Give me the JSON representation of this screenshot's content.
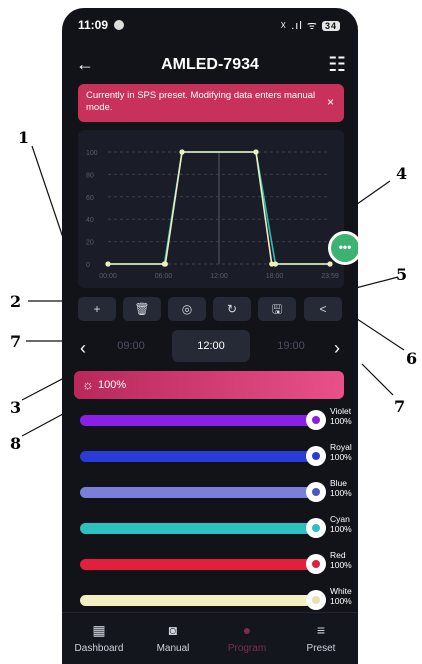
{
  "status": {
    "time": "11:09",
    "icons": "☓ .ıl ᯤ",
    "battery": "34"
  },
  "header": {
    "title": "AMLED-7934"
  },
  "banner": {
    "text": "Currently in SPS preset. Modifying data enters manual mode.",
    "close": "×"
  },
  "chart_data": {
    "type": "line",
    "title": "",
    "y_ticks": [
      "100",
      "80",
      "60",
      "40",
      "20",
      "0"
    ],
    "x_ticks": [
      "00:00",
      "06:00",
      "12:00",
      "18:00",
      "23:59"
    ],
    "ylim": [
      0,
      100
    ],
    "xlim": [
      0,
      24
    ],
    "grid": true,
    "series": [
      {
        "color": "#f0eebc",
        "x": [
          0,
          6.1,
          6.2,
          8.0,
          16.0,
          17.7,
          18.1,
          24
        ],
        "y": [
          0,
          0,
          0,
          100,
          100,
          0,
          0,
          0
        ]
      },
      {
        "color": "#2bbcb6",
        "x": [
          0,
          6.1,
          8.0,
          16.0,
          18.1,
          24
        ],
        "y": [
          0,
          0,
          100,
          100,
          0,
          0
        ]
      }
    ],
    "cursor_x": 12
  },
  "fab": {
    "label": "•••"
  },
  "toolbar": [
    {
      "name": "add",
      "icon": "+"
    },
    {
      "name": "delete",
      "icon": "🗑"
    },
    {
      "name": "focus",
      "icon": "◎"
    },
    {
      "name": "reset",
      "icon": "↻"
    },
    {
      "name": "save",
      "icon": "🖫"
    },
    {
      "name": "share",
      "icon": "<"
    }
  ],
  "time_nav": {
    "prev": "‹",
    "next": "›",
    "slots": [
      "09:00",
      "12:00",
      "19:00"
    ]
  },
  "brightness": {
    "icon": "☼",
    "value": "100%"
  },
  "channels": [
    {
      "name": "Violet",
      "value": "100%",
      "color": "#8a1fe6",
      "knob_color": "#8a1fe6"
    },
    {
      "name": "Royal",
      "value": "100%",
      "color": "#2a3bd8",
      "knob_color": "#2a3bd8"
    },
    {
      "name": "Blue",
      "value": "100%",
      "color": "#7a80d8",
      "knob_color": "#4a55c8"
    },
    {
      "name": "Cyan",
      "value": "100%",
      "color": "#2cc1c1",
      "knob_color": "#2cc1c1"
    },
    {
      "name": "Red",
      "value": "100%",
      "color": "#e0203c",
      "knob_color": "#e0203c"
    },
    {
      "name": "White",
      "value": "100%",
      "color": "#f3efc2",
      "knob_color": "#e6e0b0"
    }
  ],
  "bottom_nav": [
    {
      "label": "Dashboard",
      "icon": "▦"
    },
    {
      "label": "Manual",
      "icon": "◙"
    },
    {
      "label": "Program",
      "icon": "●"
    },
    {
      "label": "Preset",
      "icon": "≡"
    }
  ],
  "callouts": [
    "1",
    "2",
    "3",
    "4",
    "5",
    "6",
    "7",
    "7",
    "8"
  ]
}
